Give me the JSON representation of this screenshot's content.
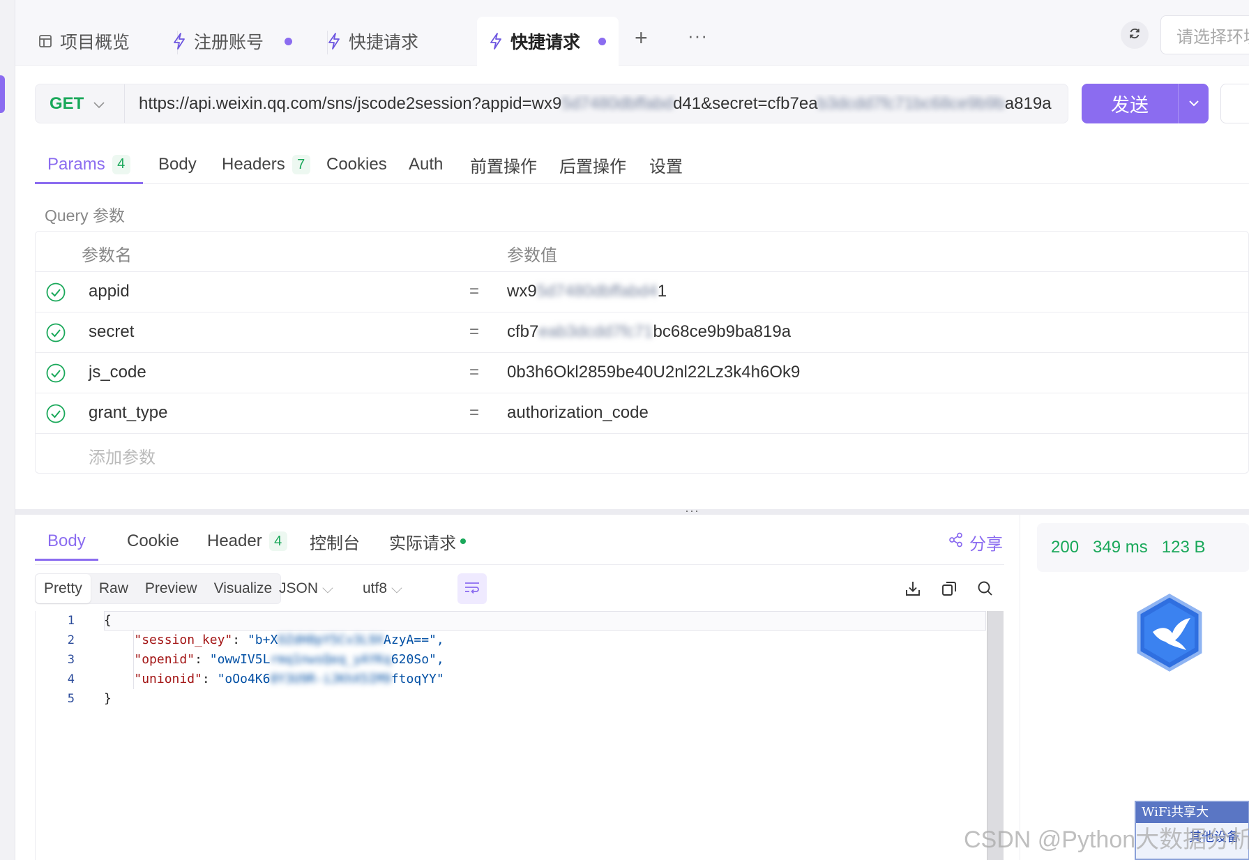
{
  "tabs": [
    {
      "label": "项目概览",
      "icon": "layout-icon",
      "unsaved": false,
      "active": false
    },
    {
      "label": "注册账号",
      "icon": "lightning-icon",
      "unsaved": true,
      "active": false
    },
    {
      "label": "快捷请求",
      "icon": "lightning-icon",
      "unsaved": false,
      "active": false
    },
    {
      "label": "快捷请求",
      "icon": "lightning-icon",
      "unsaved": true,
      "active": true
    }
  ],
  "tab_actions": {
    "add": "+",
    "more": "···"
  },
  "env": {
    "placeholder": "请选择环境"
  },
  "request": {
    "method": "GET",
    "url_prefix": "https://api.weixin.qq.com/sns/jscode2session?appid=wx9",
    "url_blur1": "5d7480dbffabd",
    "url_mid": "d41&secret=cfb7ea",
    "url_blur2": "b3dcdd7fc71bc68ce9b9b",
    "url_suffix": "a819a",
    "send_label": "发送"
  },
  "request_tabs": [
    {
      "label": "Params",
      "badge": "4",
      "active": true
    },
    {
      "label": "Body"
    },
    {
      "label": "Headers",
      "badge": "7"
    },
    {
      "label": "Cookies"
    },
    {
      "label": "Auth"
    },
    {
      "label": "前置操作"
    },
    {
      "label": "后置操作"
    },
    {
      "label": "设置"
    }
  ],
  "query_label": "Query 参数",
  "params_header": {
    "name": "参数名",
    "value": "参数值"
  },
  "params": [
    {
      "name": "appid",
      "value_prefix": "wx9",
      "value_blur": "5d7480dbffabd4",
      "value_suffix": "1"
    },
    {
      "name": "secret",
      "value_prefix": "cfb7",
      "value_blur": "eab3dcdd7fc71",
      "value_suffix": "bc68ce9b9ba819a"
    },
    {
      "name": "js_code",
      "value_prefix": "0b3h6Okl2859be40U2nl22Lz3k4h6Ok9",
      "value_blur": "",
      "value_suffix": ""
    },
    {
      "name": "grant_type",
      "value_prefix": "authorization_code",
      "value_blur": "",
      "value_suffix": ""
    }
  ],
  "add_param_placeholder": "添加参数",
  "splitter_dots": "···",
  "response_tabs": [
    {
      "label": "Body",
      "active": true
    },
    {
      "label": "Cookie"
    },
    {
      "label": "Header",
      "badge": "4"
    },
    {
      "label": "控制台"
    },
    {
      "label": "实际请求",
      "dot": true
    }
  ],
  "share_label": "分享",
  "view_modes": [
    "Pretty",
    "Raw",
    "Preview",
    "Visualize"
  ],
  "format": "JSON",
  "encoding": "utf8",
  "code_lines": [
    {
      "num": "1"
    },
    {
      "num": "2",
      "key": "\"session_key\"",
      "val_prefix": "\"b+X",
      "val_blur": "OZdH8pY5Cv3L9X",
      "val_suffix": "AzyA==\","
    },
    {
      "num": "3",
      "key": "\"openid\"",
      "val_prefix": "\"owwIV5L",
      "val_blur": "rmq1nwsQeq_yAYKq",
      "val_suffix": "620So\","
    },
    {
      "num": "4",
      "key": "\"unionid\"",
      "val_prefix": "\"oOo4K6",
      "val_blur": "0Y3U9R-iJKhX5IM9",
      "val_suffix": "ftoqYY\""
    },
    {
      "num": "5"
    }
  ],
  "status": {
    "code": "200",
    "time": "349 ms",
    "size": "123 B"
  },
  "wifi_widget": {
    "title": "WiFi共享大",
    "button": "其他设备"
  },
  "watermark": "CSDN @Python大数据分析",
  "colors": {
    "accent": "#8b6cf0",
    "success": "#1aa85a",
    "json_key": "#a31515",
    "json_string": "#0451a5"
  }
}
